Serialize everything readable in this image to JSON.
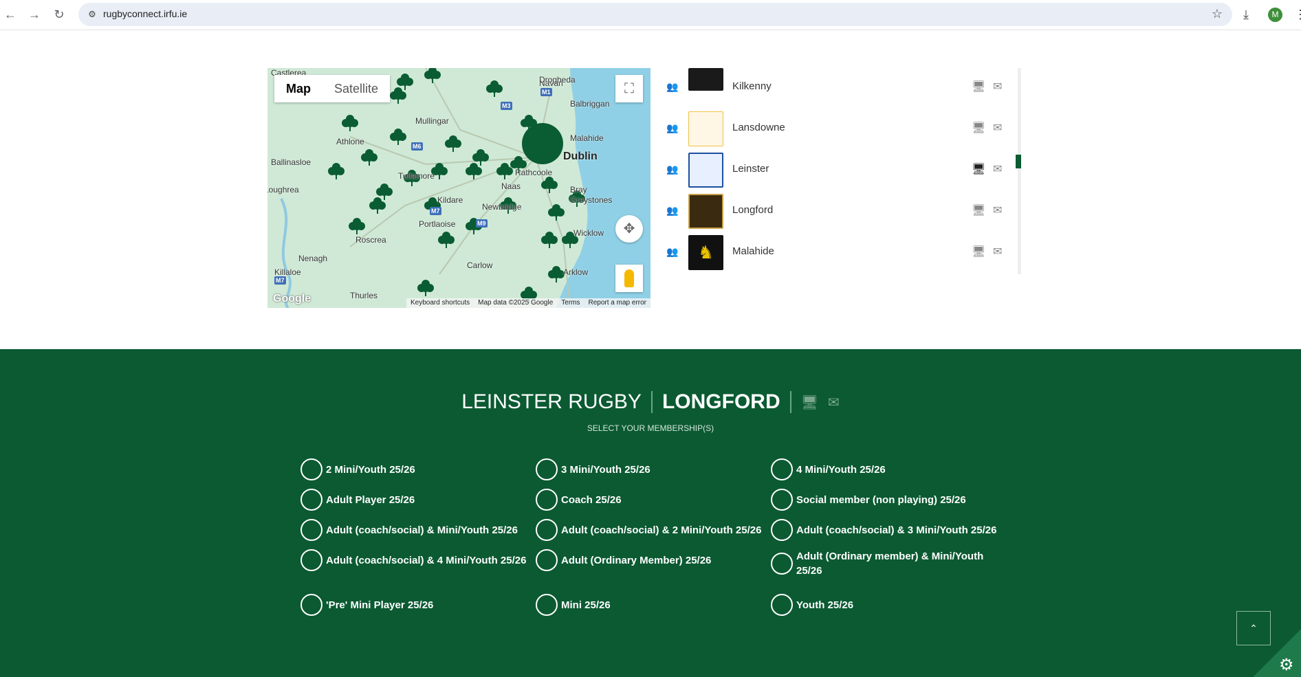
{
  "browser": {
    "url": "rugbyconnect.irfu.ie",
    "profile_initial": "M"
  },
  "map": {
    "type_map": "Map",
    "type_satellite": "Satellite",
    "footer": [
      "Keyboard shortcuts",
      "Map data ©2025 Google",
      "Terms",
      "Report a map error"
    ],
    "logo": "Google",
    "places": [
      "Castlerea",
      "Navan",
      "Drogheda",
      "Balbriggan",
      "Mullingar",
      "Athlone",
      "Malahide",
      "Ballinasloe",
      "Tullamore",
      "Dublin",
      "Loughrea",
      "Kildare",
      "Naas",
      "Rathcoole",
      "Newbridge",
      "Bray",
      "Greystones",
      "Portlaoise",
      "Roscrea",
      "Wicklow",
      "Nenagh",
      "Carlow",
      "Killaloe",
      "Arklow",
      "Thurles"
    ],
    "roads": [
      "M1",
      "M3",
      "M6",
      "M7",
      "M7",
      "M9"
    ]
  },
  "clubs": [
    {
      "name": "Kilkenny"
    },
    {
      "name": "Lansdowne"
    },
    {
      "name": "Leinster"
    },
    {
      "name": "Longford"
    },
    {
      "name": "Malahide"
    }
  ],
  "selection": {
    "league": "LEINSTER RUGBY",
    "club": "LONGFORD",
    "subtitle": "SELECT YOUR MEMBERSHIP(S)"
  },
  "memberships": [
    "2 Mini/Youth 25/26",
    "3 Mini/Youth 25/26",
    "4 Mini/Youth 25/26",
    "Adult Player 25/26",
    "Coach 25/26",
    "Social member (non playing) 25/26",
    "Adult (coach/social) & Mini/Youth 25/26",
    "Adult (coach/social) & 2 Mini/Youth 25/26",
    "Adult (coach/social) & 3 Mini/Youth 25/26",
    "Adult (coach/social) & 4 Mini/Youth 25/26",
    "Adult (Ordinary Member) 25/26",
    "Adult (Ordinary member) & Mini/Youth 25/26",
    "'Pre' Mini Player 25/26",
    "Mini 25/26",
    "Youth 25/26"
  ],
  "colors": {
    "brand_green": "#0b5a32",
    "marker_green": "#0a5c33"
  }
}
